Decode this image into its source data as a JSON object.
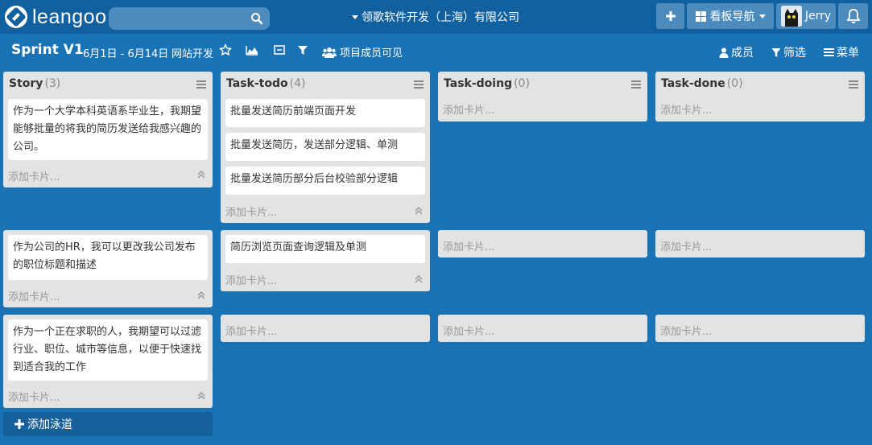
{
  "app": {
    "logo_text": "leangoo"
  },
  "search": {
    "placeholder": ""
  },
  "header": {
    "organization": "领歌软件开发（上海）有限公司",
    "board_nav_label": "看板导航",
    "user_name": "Jerry"
  },
  "sprint": {
    "title": "Sprint V1",
    "dates": "6月1日 - 6月14日",
    "project": "网站开发",
    "visibility_label": "项目成员可见",
    "members_label": "成员",
    "filter_label": "筛选",
    "menu_label": "菜单"
  },
  "columns": [
    {
      "title": "Story",
      "count": "(3)"
    },
    {
      "title": "Task-todo",
      "count": "(4)"
    },
    {
      "title": "Task-doing",
      "count": "(0)"
    },
    {
      "title": "Task-done",
      "count": "(0)"
    }
  ],
  "lanes": [
    {
      "story": [
        "作为一个大学本科英语系毕业生，我期望能够批量的将我的简历发送给我感兴趣的公司。"
      ],
      "todo": [
        "批量发送简历前端页面开发",
        "批量发送简历，发送部分逻辑、单测",
        "批量发送简历部分后台校验部分逻辑"
      ]
    },
    {
      "story": [
        "作为公司的HR，我可以更改我公司发布的职位标题和描述"
      ],
      "todo": [
        "简历浏览页面查询逻辑及单测"
      ]
    },
    {
      "story": [
        "作为一个正在求职的人，我期望可以过滤行业、职位、城市等信息，以便于快速找到适合我的工作"
      ],
      "todo": []
    }
  ],
  "add_card_label": "添加卡片...",
  "add_lane_label": "添加泳道",
  "colors": {
    "background": "#1a73b5",
    "topbar": "#1161a0",
    "list": "#e3e3e3"
  }
}
